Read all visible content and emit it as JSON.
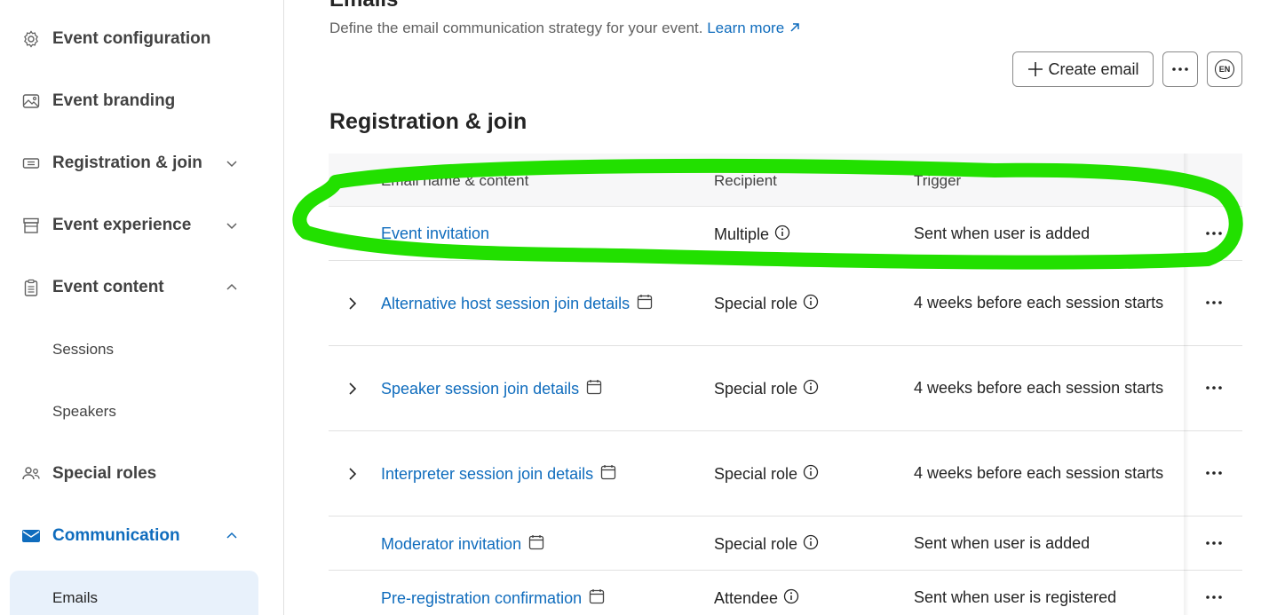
{
  "sidebar": {
    "items": [
      {
        "label": "Event configuration",
        "icon": "gear-icon",
        "chevron": "none"
      },
      {
        "label": "Event branding",
        "icon": "image-icon",
        "chevron": "none"
      },
      {
        "label": "Registration & join",
        "icon": "ticket-icon",
        "chevron": "down"
      },
      {
        "label": "Event experience",
        "icon": "store-icon",
        "chevron": "down"
      },
      {
        "label": "Event content",
        "icon": "clipboard-icon",
        "chevron": "up"
      },
      {
        "label": "Sessions",
        "sub": true
      },
      {
        "label": "Speakers",
        "sub": true
      },
      {
        "label": "Special roles",
        "icon": "people-icon",
        "chevron": "none"
      },
      {
        "label": "Communication",
        "icon": "mail-icon",
        "chevron": "up",
        "active": true
      },
      {
        "label": "Emails",
        "sub": true,
        "selected": true
      }
    ]
  },
  "header": {
    "title": "Emails",
    "description": "Define the email communication strategy for your event.",
    "learn_more": "Learn more",
    "create_label": "Create email",
    "lang_badge": "EN"
  },
  "section": {
    "title": "Registration & join"
  },
  "table": {
    "columns": [
      "Email name & content",
      "Recipient",
      "Trigger"
    ],
    "rows": [
      {
        "name": "Event invitation",
        "recipient": "Multiple",
        "trigger": "Sent when user is added",
        "expandable": false,
        "calendar": false
      },
      {
        "name": "Alternative host session join details",
        "recipient": "Special role",
        "trigger": "4 weeks before each session starts",
        "expandable": true,
        "calendar": true
      },
      {
        "name": "Speaker session join details",
        "recipient": "Special role",
        "trigger": "4 weeks before each session starts",
        "expandable": true,
        "calendar": true
      },
      {
        "name": "Interpreter session join details",
        "recipient": "Special role",
        "trigger": "4 weeks before each session starts",
        "expandable": true,
        "calendar": true
      },
      {
        "name": "Moderator invitation",
        "recipient": "Special role",
        "trigger": "Sent when user is added",
        "expandable": false,
        "calendar": true
      },
      {
        "name": "Pre-registration confirmation",
        "recipient": "Attendee",
        "trigger": "Sent when user is registered",
        "expandable": false,
        "calendar": true
      }
    ]
  },
  "colors": {
    "accent": "#0f6cbd",
    "highlight": "#22e000",
    "selected_bg": "#e8f1fb"
  }
}
